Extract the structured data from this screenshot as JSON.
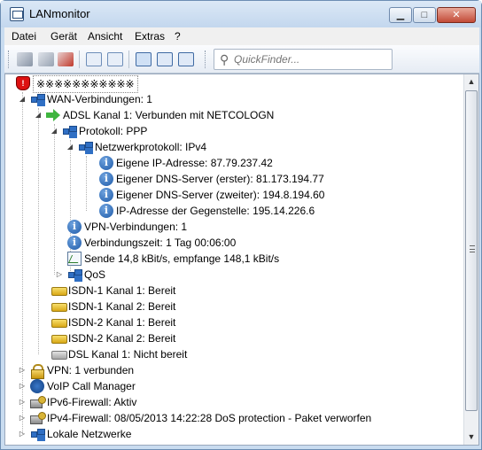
{
  "window": {
    "title": "LANmonitor"
  },
  "menu": [
    "Datei",
    "Gerät",
    "Ansicht",
    "Extras",
    "?"
  ],
  "toolbar": {
    "search_placeholder": "QuickFinder..."
  },
  "tree": {
    "root": {
      "label": "※※※※※※※※※※※"
    },
    "wan": {
      "label": "WAN-Verbindungen: 1"
    },
    "adsl": {
      "label": "ADSL Kanal 1: Verbunden mit NETCOLOGN"
    },
    "protokoll": {
      "label": "Protokoll: PPP"
    },
    "netzwerkprotokoll": {
      "label": "Netzwerkprotokoll: IPv4"
    },
    "ip": {
      "label": "Eigene IP-Adresse: 87.79.237.42"
    },
    "dns1": {
      "label": "Eigener DNS-Server (erster): 81.173.194.77"
    },
    "dns2": {
      "label": "Eigener DNS-Server (zweiter): 194.8.194.60"
    },
    "gegenstelle": {
      "label": "IP-Adresse der Gegenstelle: 195.14.226.6"
    },
    "vpn_conn": {
      "label": "VPN-Verbindungen: 1"
    },
    "zeit": {
      "label": "Verbindungszeit: 1 Tag 00:06:00"
    },
    "sende": {
      "label": "Sende 14,8 kBit/s, empfange 148,1 kBit/s"
    },
    "qos": {
      "label": "QoS"
    },
    "isdn1k1": {
      "label": "ISDN-1 Kanal 1: Bereit"
    },
    "isdn1k2": {
      "label": "ISDN-1 Kanal 2: Bereit"
    },
    "isdn2k1": {
      "label": "ISDN-2 Kanal 1: Bereit"
    },
    "isdn2k2": {
      "label": "ISDN-2 Kanal 2: Bereit"
    },
    "dsl": {
      "label": "DSL Kanal 1: Nicht bereit"
    },
    "vpn": {
      "label": "VPN: 1 verbunden"
    },
    "voip": {
      "label": "VoIP Call Manager"
    },
    "ipv6fw": {
      "label": "IPv6-Firewall: Aktiv"
    },
    "ipv4fw": {
      "label": "IPv4-Firewall: 08/05/2013 14:22:28 DoS protection - Paket verworfen"
    },
    "lokal": {
      "label": "Lokale Netzwerke"
    }
  }
}
